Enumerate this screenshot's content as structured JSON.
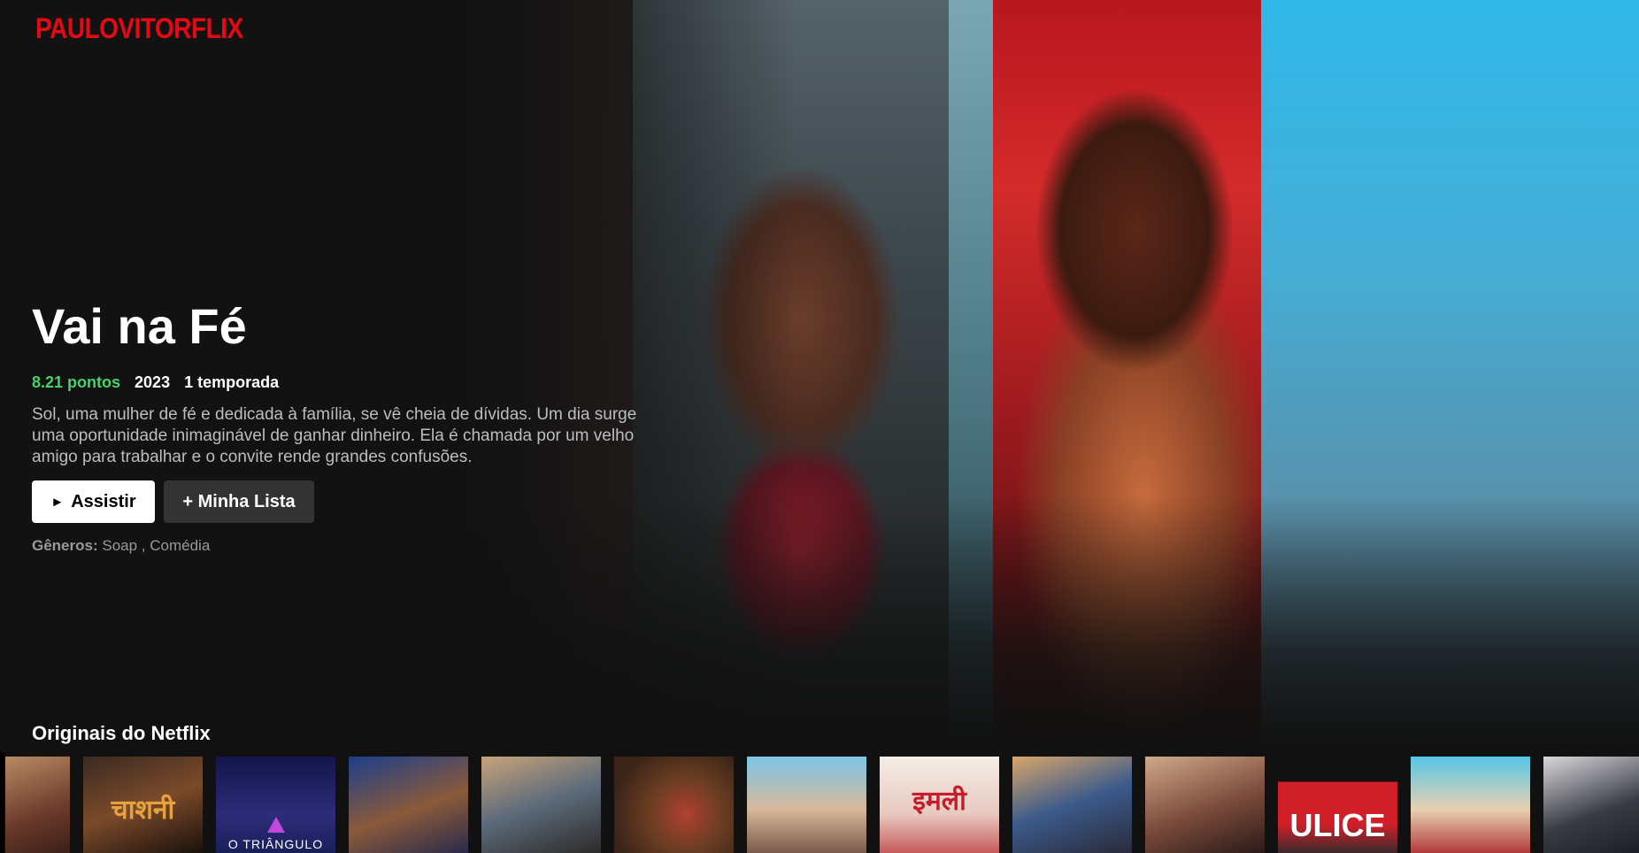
{
  "brand": {
    "logo": "PAULOVITORFLIX",
    "color": "#e50914"
  },
  "featured": {
    "title": "Vai na Fé",
    "points": "8.21 pontos",
    "year": "2023",
    "seasons": "1 temporada",
    "description": "Sol, uma mulher de fé e dedicada à família, se vê cheia de dívidas. Um dia surge uma oportunidade inimaginável de ganhar dinheiro. Ela é chamada por um velho amigo para trabalhar e o convite rende grandes confusões.",
    "play_icon": "►",
    "play_label": "Assistir",
    "list_label": "+ Minha Lista",
    "genres_label": "Gêneros:",
    "genres_value": "Soap , Comédia",
    "points_color": "#46d369"
  },
  "rows": [
    {
      "title": "Originais do Netflix",
      "items": [
        {
          "title": ""
        },
        {
          "title": "चाशनी"
        },
        {
          "title": "O TRIÂNGULO"
        },
        {
          "title": ""
        },
        {
          "title": ""
        },
        {
          "title": ""
        },
        {
          "title": ""
        },
        {
          "title": "इमली"
        },
        {
          "title": ""
        },
        {
          "title": ""
        },
        {
          "title": "ULICE"
        },
        {
          "title": ""
        },
        {
          "title": ""
        }
      ]
    }
  ]
}
